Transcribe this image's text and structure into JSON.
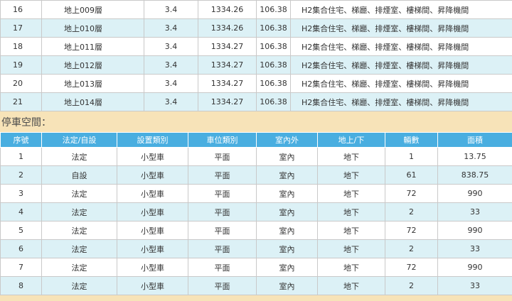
{
  "floor_rows": [
    {
      "no": "16",
      "floor": "地上009層",
      "height": "3.4",
      "area": "1334.26",
      "value": "106.38",
      "use": "H2集合住宅、梯廳、排煙室、樓梯間、昇降機間"
    },
    {
      "no": "17",
      "floor": "地上010層",
      "height": "3.4",
      "area": "1334.26",
      "value": "106.38",
      "use": "H2集合住宅、梯廳、排煙室、樓梯間、昇降機間"
    },
    {
      "no": "18",
      "floor": "地上011層",
      "height": "3.4",
      "area": "1334.27",
      "value": "106.38",
      "use": "H2集合住宅、梯廳、排煙室、樓梯間、昇降機間"
    },
    {
      "no": "19",
      "floor": "地上012層",
      "height": "3.4",
      "area": "1334.27",
      "value": "106.38",
      "use": "H2集合住宅、梯廳、排煙室、樓梯間、昇降機間"
    },
    {
      "no": "20",
      "floor": "地上013層",
      "height": "3.4",
      "area": "1334.27",
      "value": "106.38",
      "use": "H2集合住宅、梯廳、排煙室、樓梯間、昇降機間"
    },
    {
      "no": "21",
      "floor": "地上014層",
      "height": "3.4",
      "area": "1334.27",
      "value": "106.38",
      "use": "H2集合住宅、梯廳、排煙室、樓梯間、昇降機間"
    }
  ],
  "parking": {
    "title": "停車空間：",
    "headers": [
      "序號",
      "法定/自設",
      "設置類別",
      "車位類別",
      "室內外",
      "地上/下",
      "輛數",
      "面積"
    ],
    "rows": [
      [
        "1",
        "法定",
        "小型車",
        "平面",
        "室內",
        "地下",
        "1",
        "13.75"
      ],
      [
        "2",
        "自設",
        "小型車",
        "平面",
        "室內",
        "地下",
        "61",
        "838.75"
      ],
      [
        "3",
        "法定",
        "小型車",
        "平面",
        "室內",
        "地下",
        "72",
        "990"
      ],
      [
        "4",
        "法定",
        "小型車",
        "平面",
        "室內",
        "地下",
        "2",
        "33"
      ],
      [
        "5",
        "法定",
        "小型車",
        "平面",
        "室內",
        "地下",
        "72",
        "990"
      ],
      [
        "6",
        "法定",
        "小型車",
        "平面",
        "室內",
        "地下",
        "2",
        "33"
      ],
      [
        "7",
        "法定",
        "小型車",
        "平面",
        "室內",
        "地下",
        "72",
        "990"
      ],
      [
        "8",
        "法定",
        "小型車",
        "平面",
        "室內",
        "地下",
        "2",
        "33"
      ]
    ]
  }
}
